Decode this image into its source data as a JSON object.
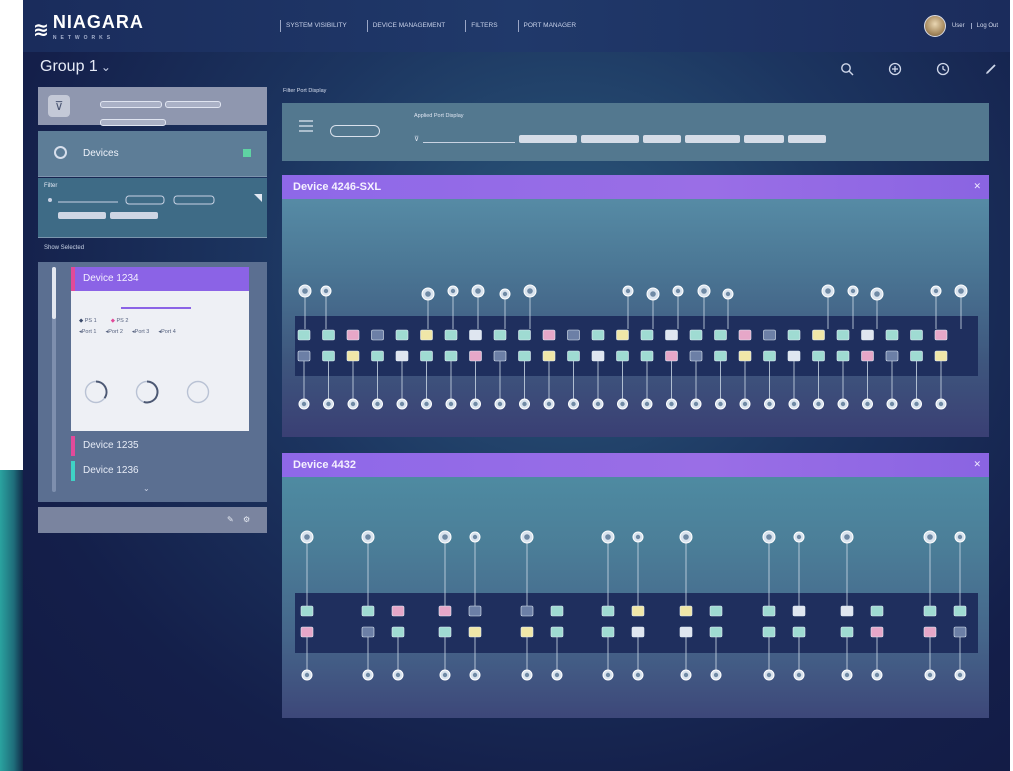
{
  "app": {
    "brand": "NIAGARA",
    "brand_sub": "NETWORKS"
  },
  "nav": [
    "SYSTEM VISIBILITY",
    "DEVICE MANAGEMENT",
    "FILTERS",
    "PORT MANAGER"
  ],
  "user": {
    "name": "User",
    "logout": "Log Out"
  },
  "page": {
    "title": "Group 1"
  },
  "toolbar_icons": [
    "search-icon",
    "add-icon",
    "history-icon",
    "edit-icon"
  ],
  "left": {
    "devices_label": "Devices",
    "devices_count": "",
    "filters_label": "Filter",
    "show_selected": "Show Selected",
    "devices": [
      {
        "name": "Device 1234",
        "color": "#8b63e6"
      },
      {
        "name": "Device 1235",
        "color": "#e24a9a"
      },
      {
        "name": "Device 1236",
        "color": "#3fd1c5"
      }
    ],
    "card": {
      "tabs": [
        "",
        "",
        ""
      ],
      "ip": "",
      "psu": [
        "PS 1",
        "PS 2"
      ],
      "ports": [
        "Port 1",
        "Port 2",
        "Port 3",
        "Port 4"
      ],
      "gauges": [
        {
          "value": "",
          "label": "",
          "level": 0.35
        },
        {
          "value": "",
          "label": "",
          "level": 0.55
        },
        {
          "value": "",
          "label": "",
          "level": 0.0
        }
      ]
    }
  },
  "filter_port": {
    "title": "Filter Port Display",
    "applied_label": "Applied Port Display",
    "button_label": ""
  },
  "panels": [
    {
      "title": "Device 4246-SXL"
    },
    {
      "title": "Device 4432"
    }
  ],
  "colors": {
    "accent_purple": "#8b63e6",
    "magenta": "#e24a9a",
    "teal": "#3fd1c5",
    "green": "#5fd3a3"
  }
}
